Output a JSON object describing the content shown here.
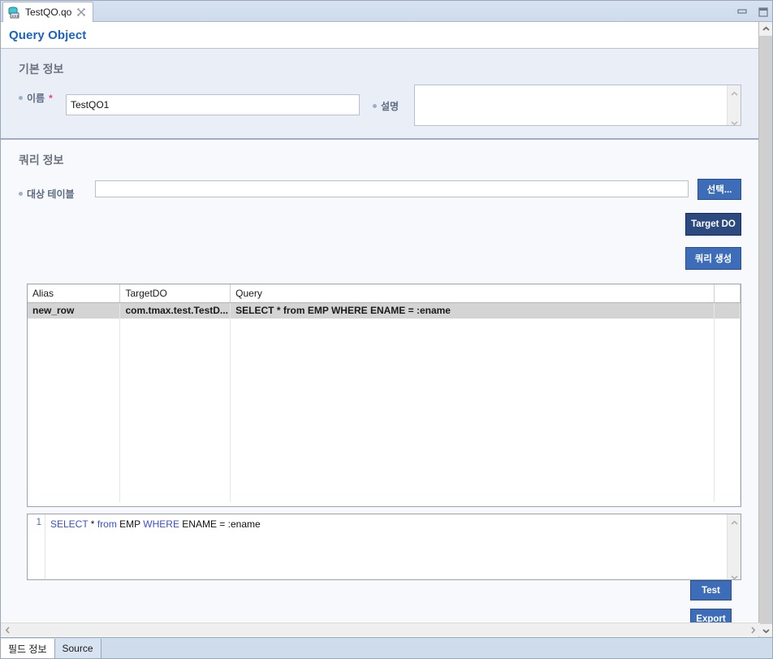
{
  "window": {
    "minimize_icon": "minimize-icon",
    "maximize_icon": "maximize-icon"
  },
  "tab": {
    "label": "TestQO.qo",
    "icon": "database-object-icon",
    "close_icon": "close-icon"
  },
  "editor": {
    "title": "Query Object"
  },
  "basic_section": {
    "title": "기본 정보",
    "name_label": "이름",
    "name_required_mark": "*",
    "name_value": "TestQO1",
    "desc_label": "설명",
    "desc_value": ""
  },
  "query_section": {
    "title": "쿼리 정보",
    "target_table_label": "대상 테이블",
    "target_table_value": "",
    "select_button": "선택...",
    "target_do_button": "Target DO",
    "generate_query_button": "쿼리 생성"
  },
  "table": {
    "columns": [
      "Alias",
      "TargetDO",
      "Query"
    ],
    "rows": [
      {
        "alias": "new_row",
        "target_do": "com.tmax.test.TestD...",
        "query": "SELECT * from EMP WHERE ENAME = :ename"
      }
    ]
  },
  "sql_editor": {
    "line_number": "1",
    "tokens": [
      {
        "text": "SELECT",
        "kind": "keyword"
      },
      {
        "text": " * ",
        "kind": "plain"
      },
      {
        "text": "from",
        "kind": "keyword"
      },
      {
        "text": " EMP ",
        "kind": "plain"
      },
      {
        "text": "WHERE",
        "kind": "keyword"
      },
      {
        "text": " ENAME = :ename",
        "kind": "plain"
      }
    ],
    "full_text": "SELECT * from EMP WHERE ENAME = :ename"
  },
  "actions": {
    "test_button": "Test",
    "export_button": "Export"
  },
  "bottom_tabs": [
    {
      "label": "필드 정보",
      "selected": true
    },
    {
      "label": "Source",
      "selected": false
    }
  ],
  "colors": {
    "accent_blue": "#1a63c4",
    "button_blue": "#3d6cb9",
    "button_blue_dark": "#2c4a80",
    "required_red": "#e0457b",
    "section_bg": "#eaeef7",
    "query_bg": "#f8f9fc",
    "selected_row": "#d4d4d4",
    "sql_keyword": "#3a4fd8"
  }
}
